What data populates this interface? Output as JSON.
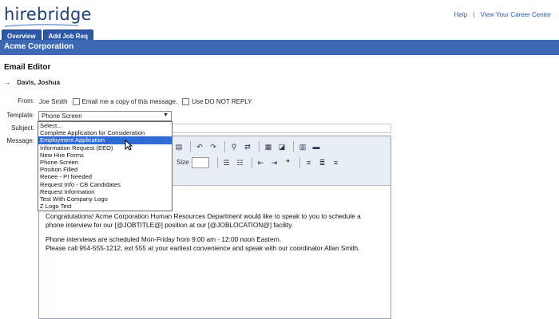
{
  "header": {
    "logo": "hirebridge",
    "links": [
      "Help",
      "View Your Career Center"
    ],
    "separator": "|"
  },
  "tabs": [
    {
      "label": "Overview"
    },
    {
      "label": "Add Job Req"
    }
  ],
  "company": "Acme Corporation",
  "page_title": "Email Editor",
  "recipient": {
    "arrow": "→",
    "name": "Davis, Joshua"
  },
  "form": {
    "from_label": "From:",
    "from_value": "Joe Smith",
    "copy_label": "Email me a copy of this message.",
    "donotreply_label": "Use DO NOT REPLY",
    "template_label": "Template:",
    "template_value": "Phone Screen",
    "subject_label": "Subject:",
    "message_label": "Message:"
  },
  "template_options": [
    "Select...",
    "Complete Application for Consideration",
    "Employment Application",
    "Information Request (EEO)",
    "New Hire Forms",
    "Phone Screen",
    "Position Filled",
    "Renee - PI Needed",
    "Request Info - CB Candidates",
    "Request Information",
    "Test With Company Logo",
    "Z Logo Test"
  ],
  "highlighted_option": "Employment Application",
  "toolbar": {
    "size_label": "Size"
  },
  "message": {
    "line1": "Congratulations! Acme Corporation Human Resources Department would like to speak to you to schedule a",
    "line2": "phone interview for our [@JOBTITLE@] position at our [@JOBLOCATION@] facility.",
    "line3": "Phone interviews are scheduled Mon-Friday from 9:00 am - 12:00 noon Eastern.",
    "line4": "Please call 954-555-1212, ext 555 at your earliest convenience and speak with our coordinator Allan Smith."
  },
  "colors": {
    "brand": "#1f3f75",
    "banner": "#3d68b4",
    "tab": "#2c5aa8",
    "highlight": "#2f6bd6",
    "link": "#2a5bb8"
  }
}
